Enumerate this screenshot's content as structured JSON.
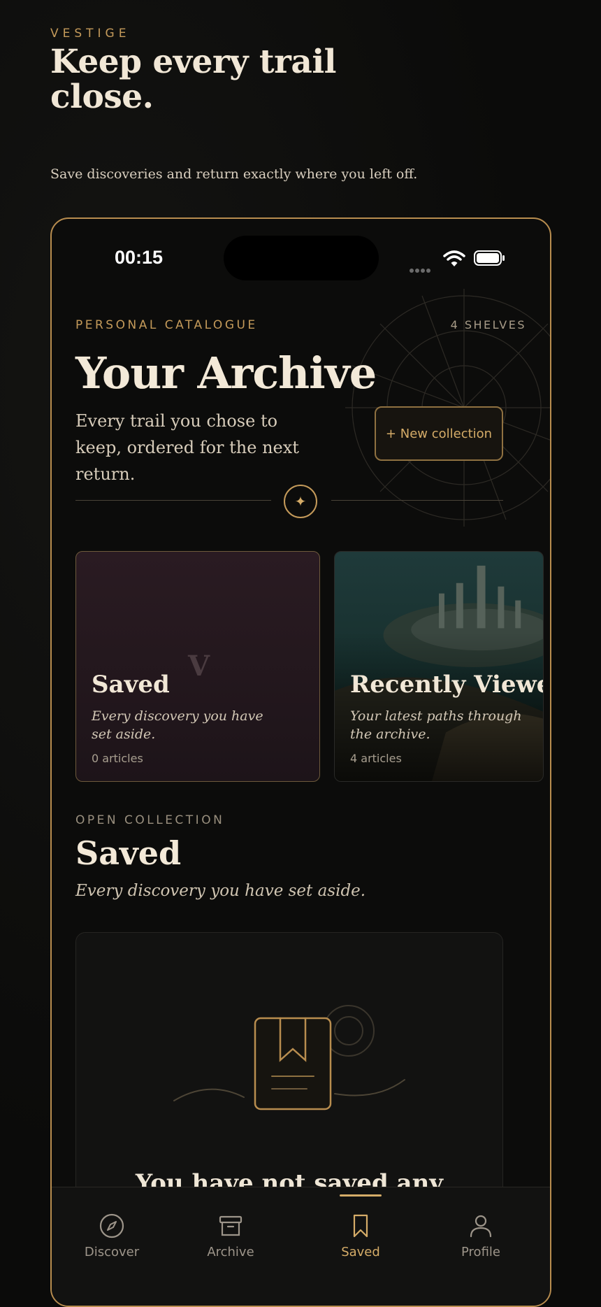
{
  "brand": "VESTIGE",
  "hero": {
    "title": "Keep every trail close.",
    "subtitle": "Save discoveries and return exactly where you left off."
  },
  "status_bar": {
    "time": "00:15"
  },
  "header": {
    "eyebrow": "PERSONAL CATALOGUE",
    "shelf_count": "4 SHELVES",
    "title": "Your Archive",
    "description": "Every trail you chose to keep, ordered for the next return.",
    "new_collection_label": "+ New collection"
  },
  "shelves": [
    {
      "title": "Saved",
      "description": "Every discovery you have set aside.",
      "count": "0 articles",
      "placeholder_glyph": "V"
    },
    {
      "title": "Recently Viewed",
      "description": "Your latest paths through the archive.",
      "count": "4 articles"
    }
  ],
  "open_collection": {
    "eyebrow": "OPEN COLLECTION",
    "title": "Saved",
    "description": "Every discovery you have set aside."
  },
  "empty_state": {
    "title": "You have not saved any"
  },
  "tabs": [
    {
      "label": "Discover",
      "icon": "compass-icon"
    },
    {
      "label": "Archive",
      "icon": "archive-box-icon"
    },
    {
      "label": "Saved",
      "icon": "bookmark-icon",
      "active": true
    },
    {
      "label": "Profile",
      "icon": "person-icon"
    }
  ],
  "colors": {
    "background": "#0b0b0a",
    "accent_gold": "#c49a5a",
    "text_primary": "#f1e7d6",
    "saved_card": "#2a1b22"
  }
}
